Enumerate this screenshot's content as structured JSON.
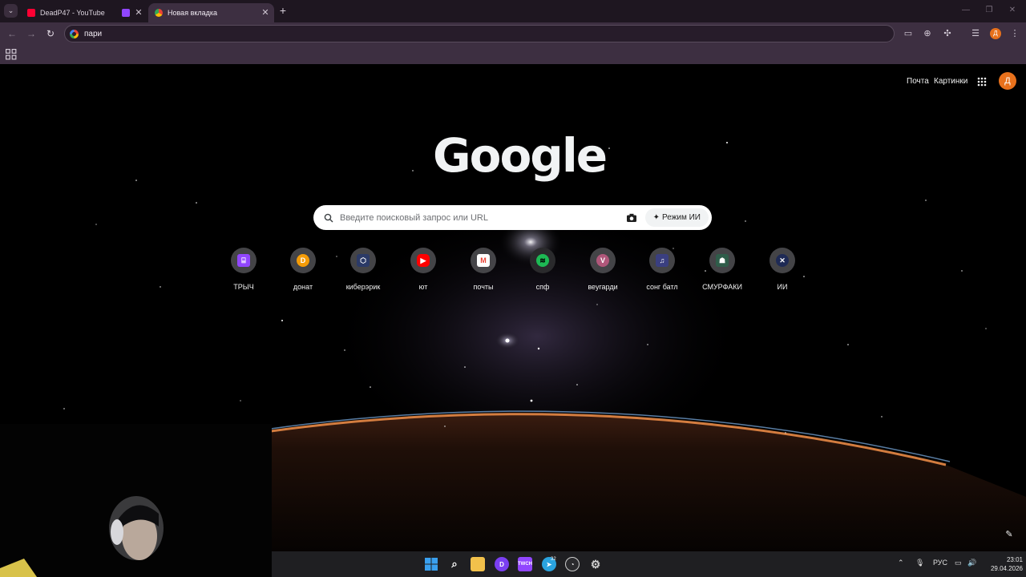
{
  "tabs": [
    {
      "title": "DeadP47 - YouTube",
      "favicon": "youtube-icon",
      "active": false
    },
    {
      "title": "",
      "favicon": "twitch-icon",
      "active": false
    },
    {
      "title": "Новая вкладка",
      "favicon": "chrome-icon",
      "active": true
    }
  ],
  "omnibox": {
    "value": "пари"
  },
  "ntp": {
    "links": {
      "mail": "Почта",
      "images": "Картинки"
    },
    "account_initial": "Д",
    "logo": "Google",
    "search_placeholder": "Введите поисковый запрос или URL",
    "ai_mode_label": "Режим ИИ",
    "shortcuts": [
      {
        "label": "ТРЫЧ",
        "icon": "twitch-icon",
        "color": "#9146ff"
      },
      {
        "label": "донат",
        "icon": "donationalerts-icon",
        "color": "#f59c07"
      },
      {
        "label": "киберэрик",
        "icon": "cyber-icon",
        "color": "#2b3a67"
      },
      {
        "label": "ют",
        "icon": "youtube-icon",
        "color": "#ff0000"
      },
      {
        "label": "почты",
        "icon": "gmail-icon",
        "color": "#ea4335"
      },
      {
        "label": "спф",
        "icon": "spotify-icon",
        "color": "#1db954"
      },
      {
        "label": "веугарди",
        "icon": "v-icon",
        "color": "#b0577a"
      },
      {
        "label": "сонг батл",
        "icon": "songbattle-icon",
        "color": "#3a3f80"
      },
      {
        "label": "СМУРФАКИ",
        "icon": "smurf-icon",
        "color": "#2f5d4a"
      },
      {
        "label": "ИИ",
        "icon": "x-icon",
        "color": "#1e2a55"
      }
    ]
  },
  "taskbar": {
    "apps": [
      "windows-start-icon",
      "search-icon",
      "file-explorer-icon",
      "twitch-studio-icon",
      "twitch-icon",
      "telegram-icon",
      "obs-icon",
      "settings-icon"
    ],
    "telegram_badge": "32",
    "lang": "РУС",
    "time": "23:01",
    "date": "29.04.2026"
  },
  "colors": {
    "accent": "#e8711c",
    "chrome_frame": "#3d2f41",
    "tabstrip": "#1e1620"
  }
}
